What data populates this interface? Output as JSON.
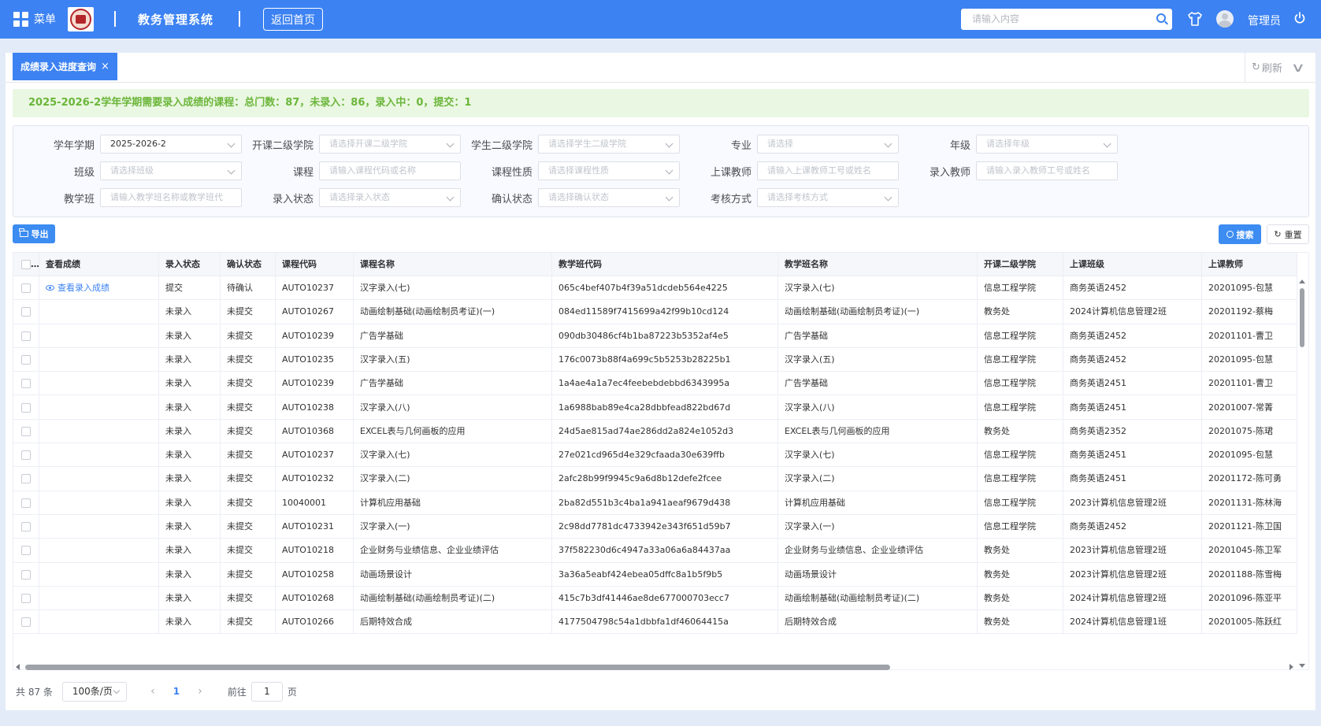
{
  "header": {
    "menu_label": "菜单",
    "system_title": "教务管理系统",
    "home_button": "返回首页",
    "search_placeholder": "请输入内容",
    "user_name": "管理员"
  },
  "tabs": {
    "active_label": "成绩录入进度查询",
    "close_glyph": "×",
    "refresh_label": "刷新",
    "refresh_glyph": "↻"
  },
  "notice": "2025-2026-2学年学期需要录入成绩的课程：总门数：87，未录入：86，录入中：0，提交：1",
  "filters": {
    "term": {
      "label": "学年学期",
      "value": "2025-2026-2",
      "placeholder": ""
    },
    "open_college": {
      "label": "开课二级学院",
      "value": "",
      "placeholder": "请选择开课二级学院"
    },
    "stu_college": {
      "label": "学生二级学院",
      "value": "",
      "placeholder": "请选择学生二级学院"
    },
    "major": {
      "label": "专业",
      "value": "",
      "placeholder": "请选择"
    },
    "grade": {
      "label": "年级",
      "value": "",
      "placeholder": "请选择年级"
    },
    "class": {
      "label": "班级",
      "value": "",
      "placeholder": "请选择班级"
    },
    "course": {
      "label": "课程",
      "value": "",
      "placeholder": "请输入课程代码或名称"
    },
    "course_type": {
      "label": "课程性质",
      "value": "",
      "placeholder": "请选择课程性质"
    },
    "teacher": {
      "label": "上课教师",
      "value": "",
      "placeholder": "请输入上课教师工号或姓名"
    },
    "entry_teacher": {
      "label": "录入教师",
      "value": "",
      "placeholder": "请输入录入教师工号或姓名"
    },
    "teach_class": {
      "label": "教学班",
      "value": "",
      "placeholder": "请输入教学班名称或教学班代"
    },
    "entry_status": {
      "label": "录入状态",
      "value": "",
      "placeholder": "请选择录入状态"
    },
    "confirm_status": {
      "label": "确认状态",
      "value": "",
      "placeholder": "请选择确认状态"
    },
    "exam_method": {
      "label": "考核方式",
      "value": "",
      "placeholder": "请选择考核方式"
    }
  },
  "buttons": {
    "export": "导出",
    "search": "搜索",
    "reset": "重置"
  },
  "table": {
    "columns": [
      "查看成绩",
      "录入状态",
      "确认状态",
      "课程代码",
      "课程名称",
      "教学班代码",
      "教学班名称",
      "开课二级学院",
      "上课班级",
      "上课教师"
    ],
    "select_all_ellipsis": "…",
    "view_link": "查看录入成绩",
    "rows": [
      [
        "查看录入成绩",
        "提交",
        "待确认",
        "AUTO10237",
        "汉字录入(七)",
        "065c4bef407b4f39a51dcdeb564e4225",
        "汉字录入(七)",
        "信息工程学院",
        "商务英语2452",
        "20201095-包慧"
      ],
      [
        "",
        "未录入",
        "未提交",
        "AUTO10267",
        "动画绘制基础(动画绘制员考证)(一)",
        "084ed11589f7415699a42f99b10cd124",
        "动画绘制基础(动画绘制员考证)(一)",
        "教务处",
        "2024计算机信息管理2班",
        "20201192-蔡梅"
      ],
      [
        "",
        "未录入",
        "未提交",
        "AUTO10239",
        "广告学基础",
        "090db30486cf4b1ba87223b5352af4e5",
        "广告学基础",
        "信息工程学院",
        "商务英语2452",
        "20201101-曹卫"
      ],
      [
        "",
        "未录入",
        "未提交",
        "AUTO10235",
        "汉字录入(五)",
        "176c0073b88f4a699c5b5253b28225b1",
        "汉字录入(五)",
        "信息工程学院",
        "商务英语2452",
        "20201095-包慧"
      ],
      [
        "",
        "未录入",
        "未提交",
        "AUTO10239",
        "广告学基础",
        "1a4ae4a1a7ec4feebebdebbd6343995a",
        "广告学基础",
        "信息工程学院",
        "商务英语2451",
        "20201101-曹卫"
      ],
      [
        "",
        "未录入",
        "未提交",
        "AUTO10238",
        "汉字录入(八)",
        "1a6988bab89e4ca28dbbfead822bd67d",
        "汉字录入(八)",
        "信息工程学院",
        "商务英语2451",
        "20201007-常菁"
      ],
      [
        "",
        "未录入",
        "未提交",
        "AUTO10368",
        "EXCEL表与几何画板的应用",
        "24d5ae815ad74ae286dd2a824e1052d3",
        "EXCEL表与几何画板的应用",
        "教务处",
        "商务英语2352",
        "20201075-陈珺"
      ],
      [
        "",
        "未录入",
        "未提交",
        "AUTO10237",
        "汉字录入(七)",
        "27e021cd965d4e329cfaada30e639ffb",
        "汉字录入(七)",
        "信息工程学院",
        "商务英语2451",
        "20201095-包慧"
      ],
      [
        "",
        "未录入",
        "未提交",
        "AUTO10232",
        "汉字录入(二)",
        "2afc28b99f9945c9a6d8b12defe2fcee",
        "汉字录入(二)",
        "信息工程学院",
        "商务英语2451",
        "20201172-陈可勇"
      ],
      [
        "",
        "未录入",
        "未提交",
        "10040001",
        "计算机应用基础",
        "2ba82d551b3c4ba1a941aeaf9679d438",
        "计算机应用基础",
        "信息工程学院",
        "2023计算机信息管理2班",
        "20201131-陈林海"
      ],
      [
        "",
        "未录入",
        "未提交",
        "AUTO10231",
        "汉字录入(一)",
        "2c98dd7781dc4733942e343f651d59b7",
        "汉字录入(一)",
        "信息工程学院",
        "商务英语2452",
        "20201121-陈卫国"
      ],
      [
        "",
        "未录入",
        "未提交",
        "AUTO10218",
        "企业财务与业绩信息、企业业绩评估",
        "37f582230d6c4947a33a06a6a84437aa",
        "企业财务与业绩信息、企业业绩评估",
        "教务处",
        "2023计算机信息管理2班",
        "20201045-陈卫军"
      ],
      [
        "",
        "未录入",
        "未提交",
        "AUTO10258",
        "动画场景设计",
        "3a36a5eabf424ebea05dffc8a1b5f9b5",
        "动画场景设计",
        "教务处",
        "2023计算机信息管理2班",
        "20201188-陈雪梅"
      ],
      [
        "",
        "未录入",
        "未提交",
        "AUTO10268",
        "动画绘制基础(动画绘制员考证)(二)",
        "415c7b3df41446ae8de677000703ecc7",
        "动画绘制基础(动画绘制员考证)(二)",
        "教务处",
        "2024计算机信息管理2班",
        "20201096-陈亚平"
      ],
      [
        "",
        "未录入",
        "未提交",
        "AUTO10266",
        "后期特效合成",
        "4177504798c54a1dbbfa1df46064415a",
        "后期特效合成",
        "教务处",
        "2024计算机信息管理1班",
        "20201005-陈跃红"
      ]
    ]
  },
  "pagination": {
    "total": "共 87 条",
    "page_size": "100条/页",
    "current_page": "1",
    "goto_label": "前往",
    "goto_value": "1",
    "page_unit": "页",
    "prev_glyph": "‹",
    "next_glyph": "›"
  }
}
